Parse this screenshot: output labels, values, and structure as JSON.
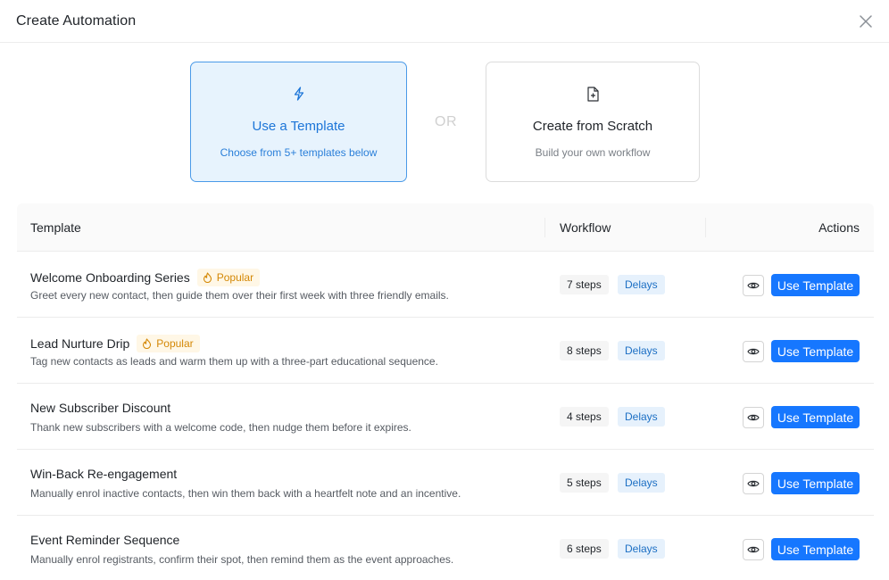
{
  "header": {
    "title": "Create Automation",
    "close_icon": "close-icon"
  },
  "options": {
    "template": {
      "title": "Use a Template",
      "subtitle": "Choose from 5+ templates below",
      "icon": "lightning-icon",
      "accent": "#1c75d8"
    },
    "or_label": "OR",
    "scratch": {
      "title": "Create from Scratch",
      "subtitle": "Build your own workflow",
      "icon": "file-plus-icon"
    }
  },
  "table": {
    "columns": {
      "template": "Template",
      "workflow": "Workflow",
      "actions": "Actions"
    },
    "rows": [
      {
        "name": "Welcome Onboarding Series",
        "popular": true,
        "popular_label": "Popular",
        "description": "Greet every new contact, then guide them over their first week with three friendly emails.",
        "steps": "7 steps",
        "tag": "Delays",
        "action": "Use Template"
      },
      {
        "name": "Lead Nurture Drip",
        "popular": true,
        "popular_label": "Popular",
        "description": "Tag new contacts as leads and warm them up with a three-part educational sequence.",
        "steps": "8 steps",
        "tag": "Delays",
        "action": "Use Template"
      },
      {
        "name": "New Subscriber Discount",
        "popular": false,
        "description": "Thank new subscribers with a welcome code, then nudge them before it expires.",
        "steps": "4 steps",
        "tag": "Delays",
        "action": "Use Template"
      },
      {
        "name": "Win-Back Re-engagement",
        "popular": false,
        "description": "Manually enrol inactive contacts, then win them back with a heartfelt note and an incentive.",
        "steps": "5 steps",
        "tag": "Delays",
        "action": "Use Template"
      },
      {
        "name": "Event Reminder Sequence",
        "popular": false,
        "description": "Manually enrol registrants, confirm their spot, then remind them as the event approaches.",
        "steps": "6 steps",
        "tag": "Delays",
        "action": "Use Template"
      }
    ]
  },
  "colors": {
    "primary": "#1677ff",
    "popular_bg": "#fff7e6",
    "popular_text": "#d48806",
    "delays_bg": "#e6f1fc",
    "delays_text": "#1c6fc4"
  }
}
